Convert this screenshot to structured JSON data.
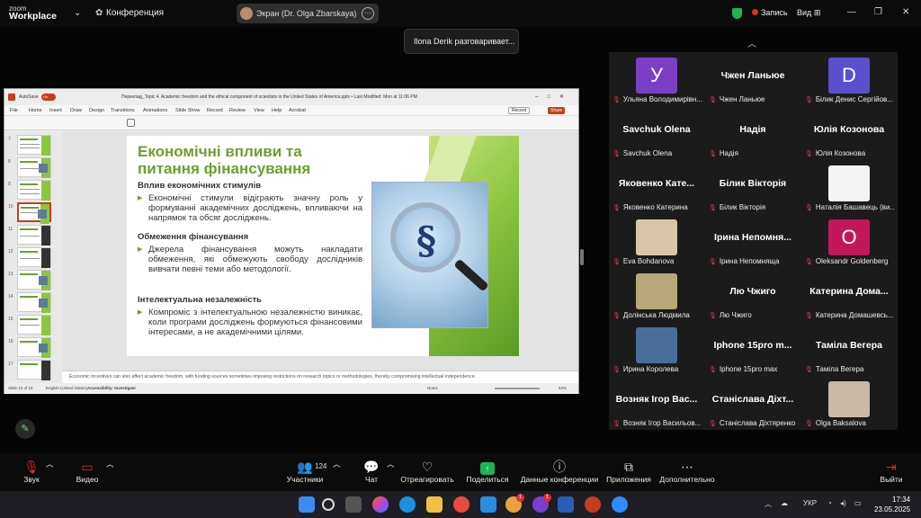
{
  "topbar": {
    "brand_small": "zoom",
    "brand_big": "Workplace",
    "meeting": "Конференция",
    "share_title": "Экран (Dr. Olga Zbarskaya)",
    "record": "Запись",
    "view": "Вид"
  },
  "speaking": "Ilona Derik разговаривает...",
  "ppt": {
    "autosave": "AutoSave",
    "toggle": "On",
    "title": "Переклад_Topic 4. Academic freedom and the ethical component of scientists in the United States of America.pptx • Last Modified: Mon at 11:06 PM",
    "tabs": [
      "File",
      "Home",
      "Insert",
      "Draw",
      "Design",
      "Transitions",
      "Animations",
      "Slide Show",
      "Record",
      "Review",
      "View",
      "Help",
      "Acrobat"
    ],
    "record_btn": "Record",
    "share_btn": "Share",
    "thumb_numbers": [
      "7",
      "8",
      "9",
      "10",
      "11",
      "12",
      "13",
      "14",
      "15",
      "16",
      "17"
    ],
    "slide": {
      "title_line1": "Економічні впливи та",
      "title_line2": "питання фінансування",
      "h1": "Вплив економічних стимулів",
      "b1": "Економічні стимули відіграють значну роль у формуванні академічних досліджень, впливаючи на напрямок та обсяг досліджень.",
      "h2": "Обмеження фінансування",
      "b2": "Джерела фінансування можуть накладати обмеження, які обмежують свободу дослідників вивчати певні теми або методології.",
      "h3": "Інтелектуальна незалежність",
      "b3": "Компроміс з інтелектуальною незалежністю виникає, коли програми досліджень формуються фінансовими інтересами, а не академічними цілями.",
      "symbol": "§"
    },
    "notes": "Economic incentives can also affect academic freedom, with funding sources sometimes imposing restrictions on research topics or methodologies, thereby compromising intellectual independence.",
    "status": {
      "slide": "Slide 10 of 15",
      "lang": "English (United States)",
      "access": "Accessibility: Investigate",
      "notes": "Notes",
      "zoom": "62%"
    }
  },
  "participants": [
    {
      "big": "",
      "avatar": "У",
      "avatar_color": "#7a3fc4",
      "label": "Ульяна Володимирівн..."
    },
    {
      "big": "Чжен Ланьюе",
      "avatar": "",
      "avatar_color": "",
      "label": "Чжен Ланьюе"
    },
    {
      "big": "",
      "avatar": "D",
      "avatar_color": "#5a4fcf",
      "label": "Білик Денис Сергійов..."
    },
    {
      "big": "Savchuk Olena",
      "avatar": "",
      "avatar_color": "",
      "label": "Savchuk Olena"
    },
    {
      "big": "Надія",
      "avatar": "",
      "avatar_color": "",
      "label": "Надія"
    },
    {
      "big": "Юлія Козонова",
      "avatar": "",
      "avatar_color": "",
      "label": "Юлія Козонова"
    },
    {
      "big": "Яковенко Кате...",
      "avatar": "",
      "avatar_color": "",
      "label": "Яковенко Катерина"
    },
    {
      "big": "Білик Вікторія",
      "avatar": "",
      "avatar_color": "",
      "label": "Білик Вікторія"
    },
    {
      "big": "",
      "avatar": "",
      "avatar_color": "#f4f4f4",
      "label": "Наталія Башавець (ви..."
    },
    {
      "big": "",
      "avatar": "",
      "avatar_color": "#d8c6a8",
      "label": "Eva Bohdanova"
    },
    {
      "big": "Ірина Непомня...",
      "avatar": "",
      "avatar_color": "",
      "label": "Ірина Непомнящa"
    },
    {
      "big": "",
      "avatar": "O",
      "avatar_color": "#c2185b",
      "label": "Oleksandr Goldenberg"
    },
    {
      "big": "",
      "avatar": "",
      "avatar_color": "#b7a77a",
      "label": "Долінська Людмила"
    },
    {
      "big": "Лю Чжиго",
      "avatar": "",
      "avatar_color": "",
      "label": "Лю Чжиго"
    },
    {
      "big": "Катерина Дома...",
      "avatar": "",
      "avatar_color": "",
      "label": "Катерина Домашевсь..."
    },
    {
      "big": "",
      "avatar": "",
      "avatar_color": "#4a6d98",
      "label": "Ирина Королева"
    },
    {
      "big": "Iphone 15pro m...",
      "avatar": "",
      "avatar_color": "",
      "label": "Iphone 15pro max"
    },
    {
      "big": "Таміла Вегера",
      "avatar": "",
      "avatar_color": "",
      "label": "Таміла Вегера"
    },
    {
      "big": "Возняк Ігор Вас...",
      "avatar": "",
      "avatar_color": "",
      "label": "Возняк Ігор Васильов..."
    },
    {
      "big": "Станіслава Діхт...",
      "avatar": "",
      "avatar_color": "",
      "label": "Станіслава Діхтяренко"
    },
    {
      "big": "",
      "avatar": "",
      "avatar_color": "#c9b9a8",
      "label": "Olga Baksalova"
    }
  ],
  "toolbar": {
    "audio": "Звук",
    "video": "Видео",
    "participants": "Участники",
    "participants_count": "124",
    "chat": "Чат",
    "react": "Отреагировать",
    "share": "Поделиться",
    "info": "Данные конференции",
    "apps": "Приложения",
    "more": "Дополнительно",
    "exit": "Выйти"
  },
  "taskbar": {
    "lang": "УКР",
    "time": "17:34",
    "date": "23.05.2025",
    "badge1": "1",
    "badge2": "1"
  }
}
